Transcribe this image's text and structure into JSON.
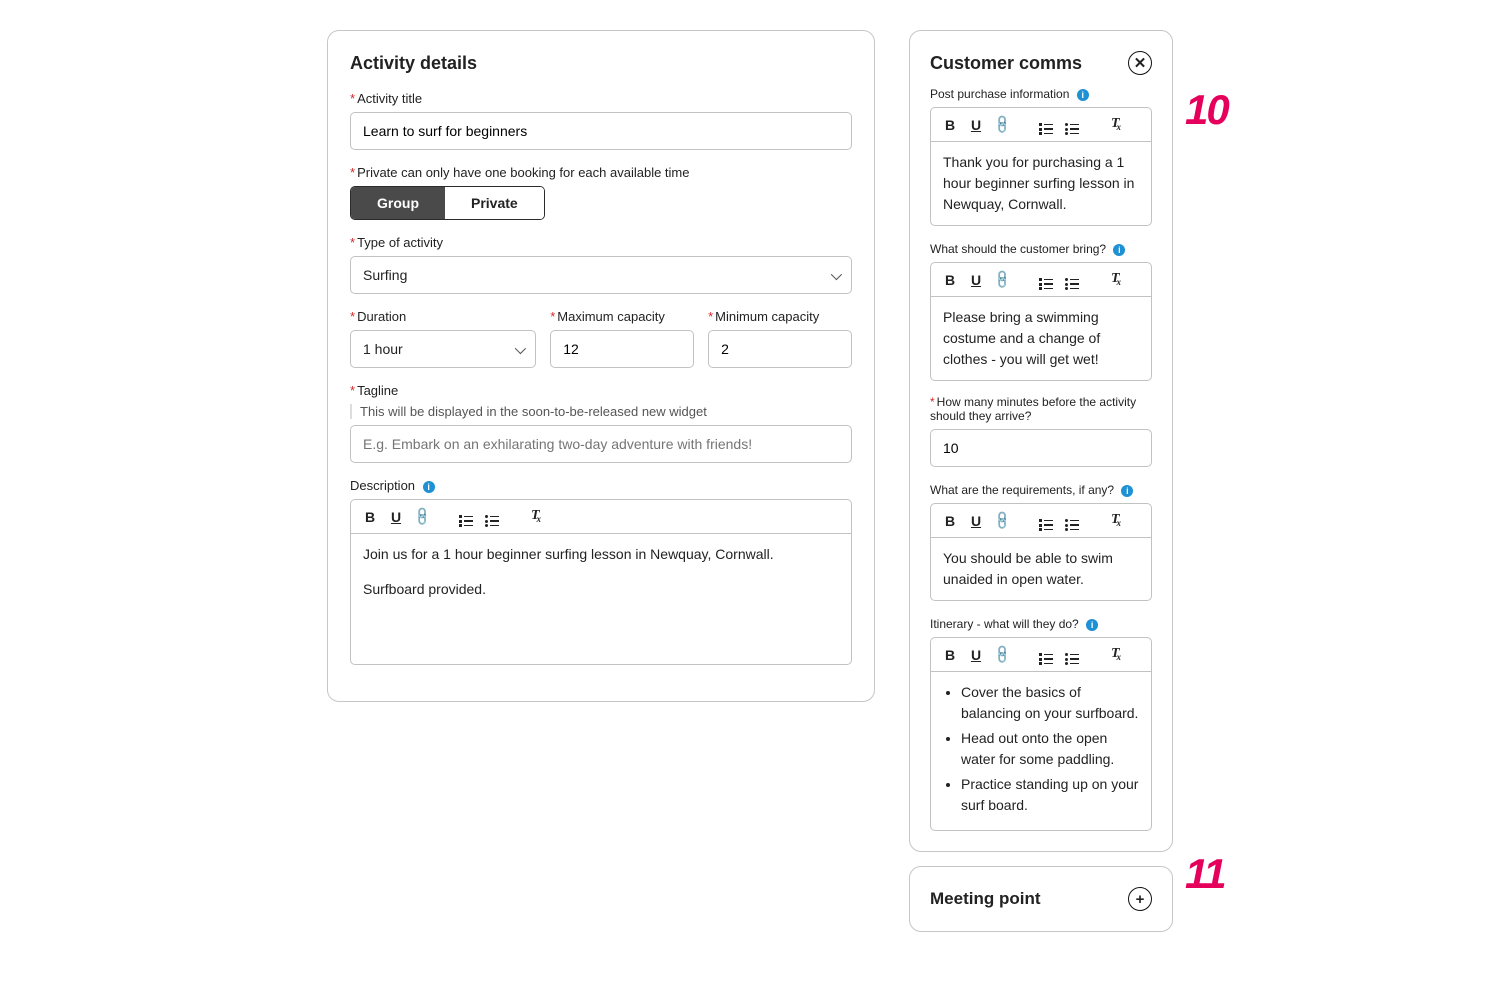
{
  "activity": {
    "title": "Activity details",
    "fields": {
      "title_label": "Activity title",
      "title_value": "Learn to surf for beginners",
      "booking_helper": "Private can only have one booking for each available time",
      "group_label": "Group",
      "private_label": "Private",
      "type_label": "Type of activity",
      "type_value": "Surfing",
      "duration_label": "Duration",
      "duration_value": "1 hour",
      "max_label": "Maximum capacity",
      "max_value": "12",
      "min_label": "Minimum capacity",
      "min_value": "2",
      "tagline_label": "Tagline",
      "tagline_helper": "This will be displayed in the soon-to-be-released new widget",
      "tagline_placeholder": "E.g. Embark on an exhilarating two-day adventure with friends!",
      "description_label": "Description",
      "description_content": {
        "p1": "Join us for a 1 hour beginner surfing lesson in Newquay, Cornwall.",
        "p2": "Surfboard provided."
      }
    }
  },
  "customer_comms": {
    "title": "Customer comms",
    "post_purchase": {
      "label": "Post purchase information",
      "content": "Thank you for purchasing a 1 hour beginner surfing lesson in Newquay, Cornwall."
    },
    "bring": {
      "label": "What should the customer bring?",
      "content": "Please bring a swimming costume and a change of clothes - you will get wet!"
    },
    "arrive": {
      "label": "How many minutes before the activity should they arrive?",
      "value": "10"
    },
    "requirements": {
      "label": "What are the requirements, if any?",
      "content": "You should be able to swim unaided in open water."
    },
    "itinerary": {
      "label": "Itinerary - what will they do?",
      "items": [
        "Cover the basics of balancing on your surfboard.",
        "Head out onto the open water for some paddling.",
        "Practice standing up on your surf board."
      ]
    }
  },
  "meeting": {
    "title": "Meeting point"
  },
  "steps": {
    "s10": "10",
    "s11": "11"
  },
  "glyphs": {
    "info": "i",
    "close": "✕",
    "plus": "+",
    "bold": "B",
    "underline": "U",
    "link": "🔗",
    "italic_t": "T",
    "italic_x": "x"
  }
}
